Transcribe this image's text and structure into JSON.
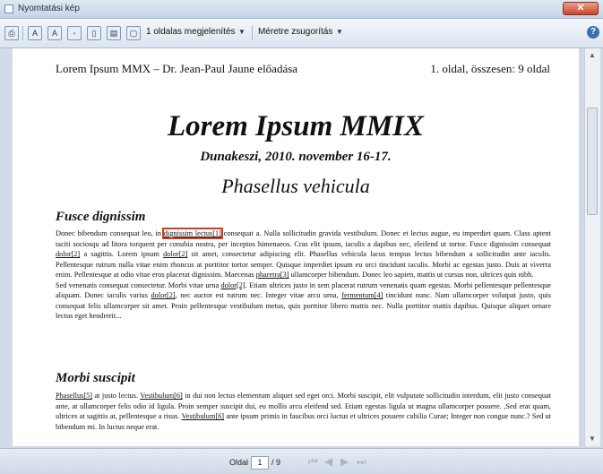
{
  "window": {
    "title": "Nyomtatási kép"
  },
  "toolbar": {
    "layout_label": "1 oldalas megjelenítés",
    "zoom_label": "Méretre zsugorítás"
  },
  "document": {
    "header_left": "Lorem Ipsum MMX – Dr. Jean-Paul Jaune előadása",
    "header_right": "1. oldal, összesen: 9 oldal",
    "title": "Lorem Ipsum MMIX",
    "subtitle": "Dunakeszi, 2010. november 16-17.",
    "heading": "Phasellus vehicula",
    "section1": {
      "title": "Fusce dignissim",
      "p1_before": "Donec bibendum consequat leo, in ",
      "p1_link_highlighted": "dignissim lectus[1]",
      "p1_mid1": " consequat a. Nulla sollicitudin gravida vestibulum. Donec et lectus augue, eu imperdiet quam. Class aptent taciti sociosqu ad litora torquent per conubia nostra, per inceptos himenaeos. Cras elit ipsum, iaculis a dapibus nec, eleifend ut tortor. Fusce dignissim consequat ",
      "p1_link2": "dolor[2]",
      "p1_mid2": " a sagittis. Lorem ipsum ",
      "p1_link3": "dolor[2]",
      "p1_mid3": " sit amet, consectetur adipiscing elit. Phasellus vehicula lacus tempus lectus bibendum a sollicitudin ante iaculis. Pellentesque rutrum nulla vitae enim rhoncus at porttitor tortor semper. Quisque imperdiet ipsum eu orci tincidunt iaculis. Morbi ac egestas justo. Duis at viverra enim. Pellentesque at odio vitae eros placerat dignissim. Maecenas ",
      "p1_link4": "pharetra[3]",
      "p1_end": " ullamcorper bibendum. Donec leo sapien, mattis ut cursus non, ultrices quis nibh.",
      "p2_before": "Sed venenatis consequat consectetur. Morbi vitae urna ",
      "p2_link1": "dolor[2]",
      "p2_mid1": ". Etiam ultrices justo in sem placerat rutrum venenatis quam egestas. Morbi pellentesque pellentesque aliquam. Donec iaculis varius ",
      "p2_link2": "dolor[2]",
      "p2_mid2": ", nec auctor est rutrum nec. Integer vitae arcu urna, ",
      "p2_link3": "fermentum[4]",
      "p2_end": " tincidunt nunc. Nam ullamcorper volutpat justo, quis consequat felis ullamcorper sit amet. Proin pellentesque vestibulum metus, quis porttitor libero mattis nec. Nulla porttitor mattis dapibus. Quisque aliquet ornare lectus eget hendrerit..."
    },
    "section2": {
      "title": "Morbi suscipit",
      "p1_link1": "Phasellus[5]",
      "p1_mid1": " at justo lectus. ",
      "p1_link2": "Vestibulum[6]",
      "p1_mid2": " in dui non lectus elementum aliquet sed eget orci. Morbi suscipit, elit vulputate sollicitudin interdum, elit justo consequat ante, at ullamcorper felis odio id ligula. Proin semper suscipit dui, eu mollis arcu eleifend sed. Etiam egestas ligula ut magna ullamcorper posuere. ,Sed erat quam, ultrices at sagittis at, pellentesque a risus. ",
      "p1_link3": "Vestibulum[6]",
      "p1_end": " ante ipsum primis in faucibus orci luctus et ultrices posuere cubilia Curae; Integer non congue nunc.? Sed ut bibendum mi. In luctus neque erat."
    }
  },
  "status": {
    "page_label": "Oldal",
    "current_page": "1",
    "total_pages": "/ 9"
  },
  "colors": {
    "highlight": "#d63a1f",
    "close_button": "#c8452b"
  }
}
